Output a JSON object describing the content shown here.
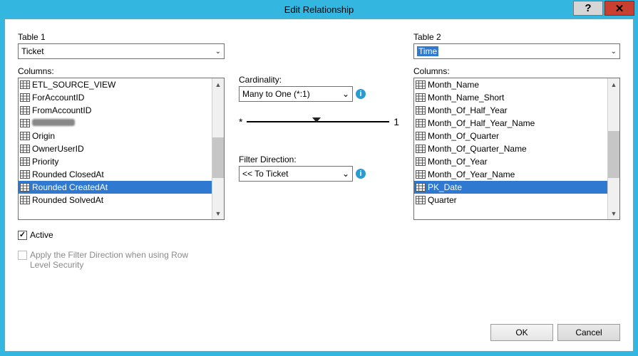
{
  "window": {
    "title": "Edit Relationship"
  },
  "left": {
    "table_label": "Table 1",
    "table_value": "Ticket",
    "columns_label": "Columns:",
    "items": [
      {
        "label": "ETL_SOURCE_VIEW"
      },
      {
        "label": "ForAccountID"
      },
      {
        "label": "FromAccountID"
      },
      {
        "label": ""
      },
      {
        "label": "Origin"
      },
      {
        "label": "OwnerUserID"
      },
      {
        "label": "Priority"
      },
      {
        "label": "Rounded ClosedAt"
      },
      {
        "label": "Rounded CreatedAt",
        "selected": true
      },
      {
        "label": "Rounded SolvedAt"
      }
    ]
  },
  "right": {
    "table_label": "Table 2",
    "table_value": "Time",
    "columns_label": "Columns:",
    "items": [
      {
        "label": "Month_Name"
      },
      {
        "label": "Month_Name_Short"
      },
      {
        "label": "Month_Of_Half_Year"
      },
      {
        "label": "Month_Of_Half_Year_Name"
      },
      {
        "label": "Month_Of_Quarter"
      },
      {
        "label": "Month_Of_Quarter_Name"
      },
      {
        "label": "Month_Of_Year"
      },
      {
        "label": "Month_Of_Year_Name"
      },
      {
        "label": "PK_Date",
        "selected": true
      },
      {
        "label": "Quarter"
      }
    ]
  },
  "mid": {
    "cardinality_label": "Cardinality:",
    "cardinality_value": "Many to One (*:1)",
    "rel_left_symbol": "*",
    "rel_right_symbol": "1",
    "filter_label": "Filter Direction:",
    "filter_value": "<< To Ticket"
  },
  "checks": {
    "active_label": "Active",
    "rls_label": "Apply the Filter Direction when using Row Level Security"
  },
  "buttons": {
    "ok": "OK",
    "cancel": "Cancel"
  },
  "icons": {
    "info": "i",
    "dropdown": "⌄",
    "up": "▲",
    "down": "▼",
    "help": "?",
    "close": "✕"
  }
}
